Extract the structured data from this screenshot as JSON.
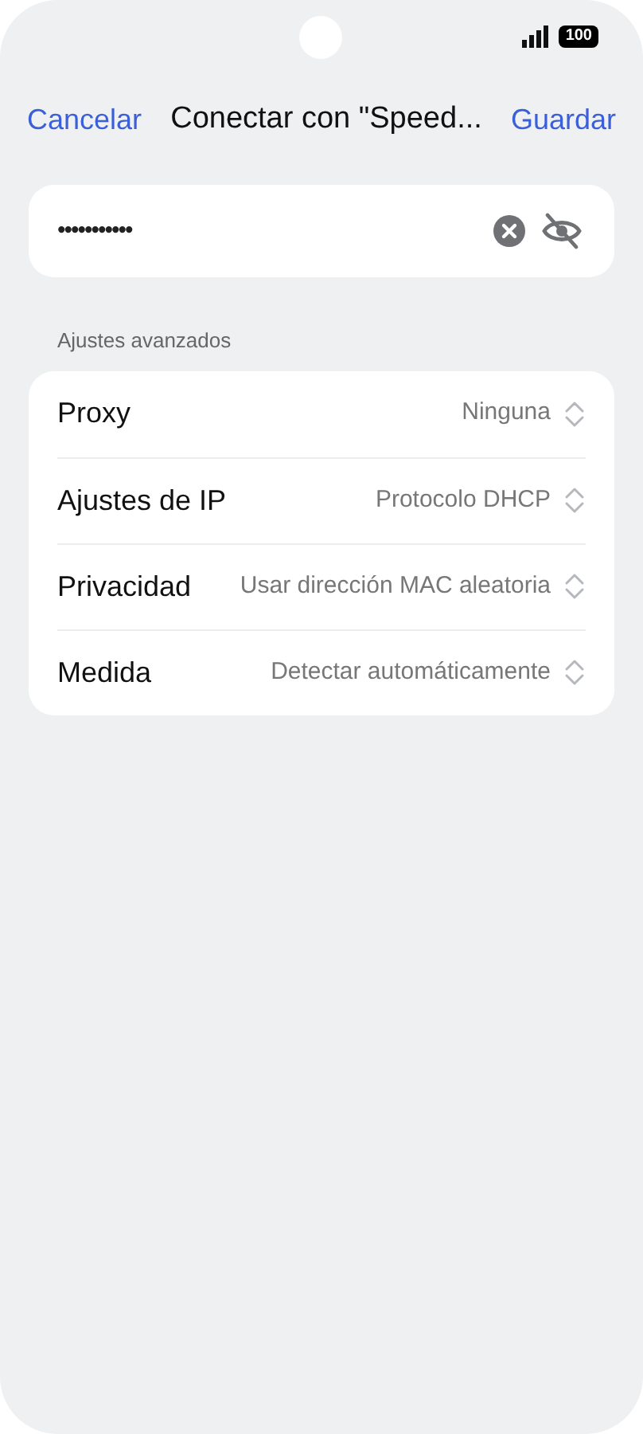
{
  "status_bar": {
    "battery": "100"
  },
  "header": {
    "cancel": "Cancelar",
    "title": "Conectar con \"Speed...",
    "save": "Guardar"
  },
  "password": {
    "value": "•••••••••••",
    "visible": false
  },
  "section": {
    "title": "Ajustes avanzados"
  },
  "settings": [
    {
      "label": "Proxy",
      "value": "Ninguna"
    },
    {
      "label": "Ajustes de IP",
      "value": "Protocolo DHCP"
    },
    {
      "label": "Privacidad",
      "value": "Usar dirección MAC aleatoria"
    },
    {
      "label": "Medida",
      "value": "Detectar automáticamente"
    }
  ]
}
